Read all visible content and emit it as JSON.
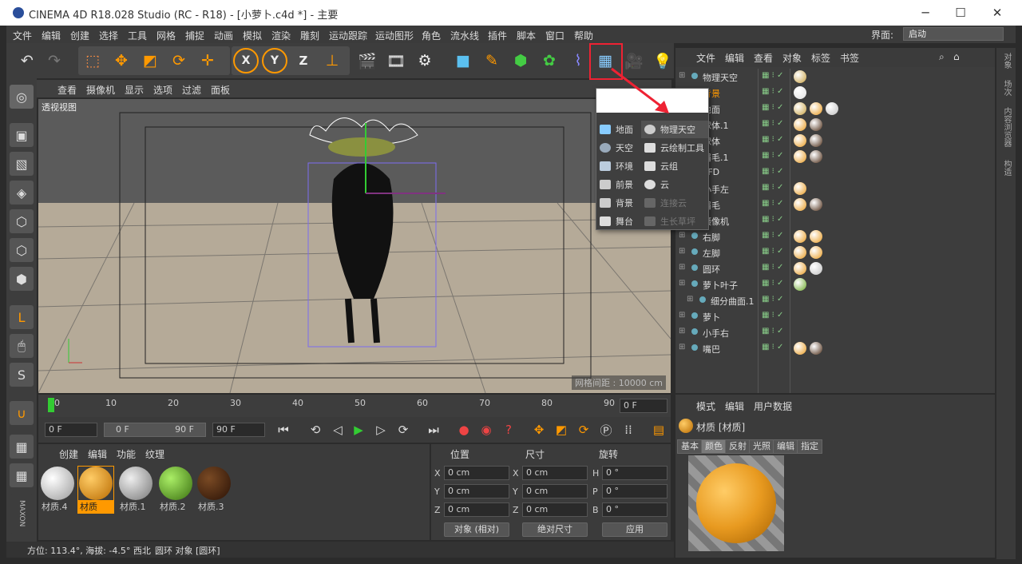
{
  "window": {
    "title": "CINEMA 4D R18.028 Studio (RC - R18) - [小萝卜.c4d *] - 主要"
  },
  "menu": {
    "items": [
      "文件",
      "编辑",
      "创建",
      "选择",
      "工具",
      "网格",
      "捕捉",
      "动画",
      "模拟",
      "渲染",
      "雕刻",
      "运动跟踪",
      "运动图形",
      "角色",
      "流水线",
      "插件",
      "脚本",
      "窗口",
      "帮助"
    ],
    "layout_label": "界面:",
    "layout_value": "启动"
  },
  "viewport": {
    "menu": [
      "查看",
      "摄像机",
      "显示",
      "选项",
      "过滤",
      "面板"
    ],
    "label": "透视视图",
    "grid_spacing": "网格间距 : 10000 cm"
  },
  "timeline": {
    "ticks": [
      "0",
      "10",
      "20",
      "30",
      "40",
      "50",
      "60",
      "70",
      "80",
      "90"
    ],
    "frame": "0 F"
  },
  "playbar": {
    "start": "0 F",
    "range_start": "0 F",
    "range_end": "90 F",
    "end": "90 F"
  },
  "materials": {
    "menu": [
      "创建",
      "编辑",
      "功能",
      "纹理"
    ],
    "items": [
      {
        "name": "材质.4",
        "color": "#e8e8e8"
      },
      {
        "name": "材质",
        "color": "#e8a020"
      },
      {
        "name": "材质.1",
        "color": "#b8b8b8"
      },
      {
        "name": "材质.2",
        "color": "#6aa828"
      },
      {
        "name": "材质.3",
        "color": "#4a2a14"
      }
    ]
  },
  "coords": {
    "headers": [
      "位置",
      "尺寸",
      "旋转"
    ],
    "rows": [
      {
        "a": "X",
        "v1": "0 cm",
        "b": "X",
        "v2": "0 cm",
        "c": "H",
        "v3": "0 °"
      },
      {
        "a": "Y",
        "v1": "0 cm",
        "b": "Y",
        "v2": "0 cm",
        "c": "P",
        "v3": "0 °"
      },
      {
        "a": "Z",
        "v1": "0 cm",
        "b": "Z",
        "v2": "0 cm",
        "c": "B",
        "v3": "0 °"
      }
    ],
    "mode": "对象 (相对)",
    "size_mode": "绝对尺寸",
    "apply": "应用"
  },
  "status": {
    "text": "方位: 113.4°, 海拔: -4.5° 西北",
    "object": "圆环 对象 [圆环]"
  },
  "objects": {
    "menu": [
      "文件",
      "编辑",
      "查看",
      "对象",
      "标签",
      "书签"
    ],
    "rows": [
      {
        "name": "物理天空",
        "level": 0,
        "tags": [
          "#c8a040"
        ]
      },
      {
        "name": "背景",
        "level": 0,
        "highlight": true,
        "tags": [
          "#e0e0e0"
        ]
      },
      {
        "name": "地面",
        "level": 0,
        "tags": [
          "#c8a040",
          "#e89a20",
          "#c0c0c0"
        ]
      },
      {
        "name": "球体.1",
        "level": 0,
        "tags": [
          "#e89a20",
          "#4a2a14"
        ]
      },
      {
        "name": "球体",
        "level": 0,
        "tags": [
          "#e89a20",
          "#4a2a14"
        ]
      },
      {
        "name": "眉毛.1",
        "level": 0,
        "tags": [
          "#e89a20",
          "#4a2a14"
        ]
      },
      {
        "name": "FFD",
        "level": 0,
        "tags": []
      },
      {
        "name": "小手左",
        "level": 0,
        "tags": [
          "#e89a20"
        ]
      },
      {
        "name": "眉毛",
        "level": 0,
        "tags": [
          "#e89a20",
          "#4a2a14"
        ]
      },
      {
        "name": "摄像机",
        "level": 0,
        "tags": []
      },
      {
        "name": "右脚",
        "level": 0,
        "tags": [
          "#e89a20",
          "#e89a20"
        ]
      },
      {
        "name": "左脚",
        "level": 0,
        "tags": [
          "#e89a20",
          "#e89a20"
        ]
      },
      {
        "name": "圆环",
        "level": 0,
        "tags": [
          "#e89a20",
          "#c0c0c0"
        ]
      },
      {
        "name": "萝卜叶子",
        "level": 0,
        "tags": [
          "#6aa828"
        ]
      },
      {
        "name": "细分曲面.1",
        "level": 1,
        "tags": []
      },
      {
        "name": "萝卜",
        "level": 0,
        "tags": []
      },
      {
        "name": "小手右",
        "level": 0,
        "tags": []
      },
      {
        "name": "嘴巴",
        "level": 0,
        "tags": [
          "#e89a20",
          "#4a2a14"
        ]
      }
    ]
  },
  "attributes": {
    "menu": [
      "模式",
      "编辑",
      "用户数据"
    ],
    "title": "材质 [材质]",
    "tabs": [
      "基本",
      "颜色",
      "反射",
      "光照",
      "编辑",
      "指定"
    ],
    "active_tab": "颜色"
  },
  "popup": {
    "left": [
      "地面",
      "天空",
      "环境",
      "前景",
      "背景",
      "舞台"
    ],
    "right": [
      "物理天空",
      "云绘制工具",
      "云组",
      "云",
      "连接云",
      "生长草坪"
    ]
  },
  "side_tabs": [
    "对象",
    "场次",
    "内容浏览器",
    "构造"
  ]
}
